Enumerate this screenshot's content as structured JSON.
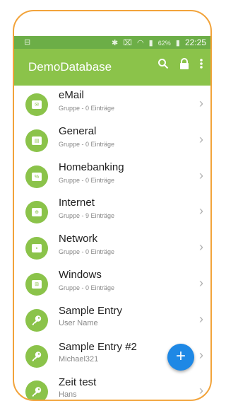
{
  "status_bar": {
    "battery": "62%",
    "time": "22:25"
  },
  "app_bar": {
    "title": "DemoDatabase",
    "actions": [
      "search-icon",
      "lock-icon",
      "more-vert-icon"
    ]
  },
  "colors": {
    "accent": "#8bc34a",
    "status_bar": "#6cae47",
    "fab": "#1e88e5",
    "frame": "#f2a33a"
  },
  "entries": [
    {
      "name": "eMail",
      "subtitle": "Gruppe - 0 Einträge",
      "icon": "mail-folder-icon"
    },
    {
      "name": "General",
      "subtitle": "Gruppe - 0 Einträge",
      "icon": "document-folder-icon"
    },
    {
      "name": "Homebanking",
      "subtitle": "Gruppe - 0 Einträge",
      "icon": "percent-folder-icon"
    },
    {
      "name": "Internet",
      "subtitle": "Gruppe - 9 Einträge",
      "icon": "globe-folder-icon"
    },
    {
      "name": "Network",
      "subtitle": "Gruppe - 0 Einträge",
      "icon": "network-folder-icon"
    },
    {
      "name": "Windows",
      "subtitle": "Gruppe - 0 Einträge",
      "icon": "windows-folder-icon"
    },
    {
      "name": "Sample Entry",
      "subtitle": "User Name",
      "icon": "key-icon"
    },
    {
      "name": "Sample Entry #2",
      "subtitle": "Michael321",
      "icon": "key-icon"
    },
    {
      "name": "Zeit test",
      "subtitle": "Hans",
      "icon": "key-icon"
    }
  ],
  "fab": {
    "label": "+"
  }
}
